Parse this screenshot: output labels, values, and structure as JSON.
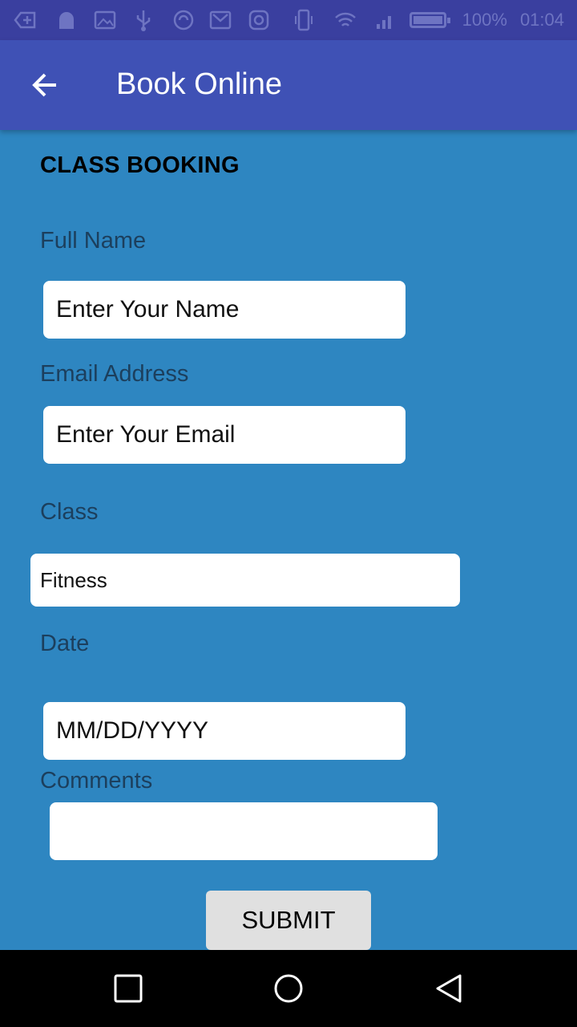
{
  "status_bar": {
    "battery_percent": "100%",
    "time": "01:04",
    "icons": [
      "add-notification-icon",
      "android-icon",
      "image-icon",
      "usb-icon",
      "sync-icon",
      "gmail-icon",
      "instagram-icon",
      "phone-vibrate-icon",
      "wifi-icon",
      "signal-icon",
      "battery-icon"
    ]
  },
  "app_bar": {
    "title": "Book Online",
    "back_icon": "arrow-back-icon"
  },
  "form": {
    "heading": "CLASS BOOKING",
    "full_name": {
      "label": "Full Name",
      "placeholder": "Enter Your Name",
      "value": ""
    },
    "email": {
      "label": "Email Address",
      "placeholder": "Enter Your Email",
      "value": ""
    },
    "class": {
      "label": "Class",
      "value": "Fitness"
    },
    "date": {
      "label": "Date",
      "placeholder": "MM/DD/YYYY",
      "value": ""
    },
    "comments": {
      "label": "Comments",
      "value": ""
    },
    "submit_label": "SUBMIT"
  },
  "nav_bar": {
    "icons": [
      "recents-square-icon",
      "home-circle-icon",
      "back-triangle-icon"
    ]
  },
  "colors": {
    "background": "#2e86c1",
    "app_bar": "#3f51b5",
    "status_bar": "#3a3f9f",
    "label_text": "#1c3f5d",
    "nav_bar": "#000000"
  }
}
